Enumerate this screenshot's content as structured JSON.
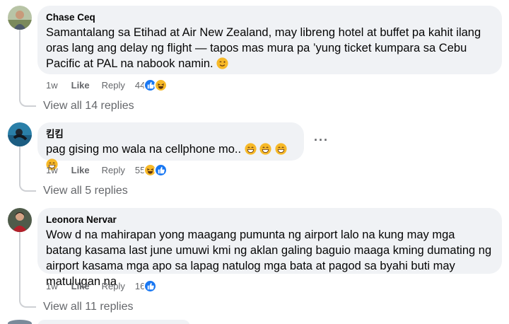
{
  "comments": [
    {
      "author": "Chase Ceq",
      "text": "Samantalang sa Etihad at Air New Zealand, may libreng hotel at buffet pa kahit ilang oras lang ang delay ng flight — tapos mas mura pa ’yung ticket kumpara sa Cebu Pacific at PAL na nabook namin.",
      "trailing_emoji": "😉",
      "time": "1w",
      "like_label": "Like",
      "reply_label": "Reply",
      "reaction_count": "44",
      "reactions": [
        "like-icon",
        "haha-icon"
      ],
      "view_replies": "View all 14 replies"
    },
    {
      "author": "킴킴",
      "text": "pag gising mo wala na cellphone mo..",
      "trailing_emoji": "😁😁😁😁",
      "time": "1w",
      "like_label": "Like",
      "reply_label": "Reply",
      "reaction_count": "55",
      "reactions": [
        "haha-icon",
        "like-icon"
      ],
      "view_replies": "View all 5 replies"
    },
    {
      "author": "Leonora Nervar",
      "text": "Wow d na mahirapan yong maagang pumunta ng airport lalo na kung may mga batang kasama last june umuwi kmi ng aklan galing baguio maaga kming dumating ng airport kasama mga apo sa lapag natulog mga bata at pagod sa byahi buti may matulugan na",
      "trailing_emoji": "",
      "time": "1w",
      "like_label": "Like",
      "reply_label": "Reply",
      "reaction_count": "16",
      "reactions": [
        "like-icon"
      ],
      "view_replies": "View all 11 replies"
    }
  ],
  "more_options": "···",
  "colors": {
    "bubble": "#f0f2f5",
    "secondary_text": "#65676b",
    "like_blue": "#1877f2",
    "haha_yellow": "#f7b928",
    "thread_line": "#ced0d4"
  }
}
